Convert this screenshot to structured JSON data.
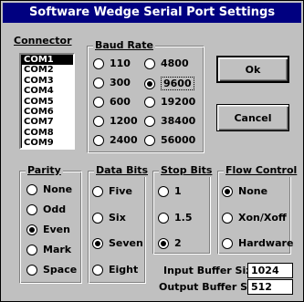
{
  "window": {
    "title": "Software Wedge Serial Port Settings"
  },
  "connector": {
    "label": "Connector",
    "items": [
      "COM1",
      "COM2",
      "COM3",
      "COM4",
      "COM5",
      "COM6",
      "COM7",
      "COM8",
      "COM9"
    ],
    "selected": "COM1"
  },
  "baud": {
    "label": "Baud  Rate",
    "options": [
      "110",
      "300",
      "600",
      "1200",
      "2400",
      "4800",
      "9600",
      "19200",
      "38400",
      "56000"
    ],
    "selected": "9600"
  },
  "parity": {
    "label": "Parity",
    "options": [
      "None",
      "Odd",
      "Even",
      "Mark",
      "Space"
    ],
    "selected": "Even"
  },
  "databits": {
    "label": "Data Bits",
    "options": [
      "Five",
      "Six",
      "Seven",
      "Eight"
    ],
    "selected": "Seven"
  },
  "stopbits": {
    "label": "Stop Bits",
    "options": [
      "1",
      "1.5",
      "2"
    ],
    "selected": "2"
  },
  "flow": {
    "label": "Flow Control",
    "options": [
      "None",
      "Xon/Xoff",
      "Hardware"
    ],
    "selected": "None"
  },
  "buttons": {
    "ok": "Ok",
    "cancel": "Cancel"
  },
  "buffers": {
    "input_label": "Input Buffer Size:",
    "input_value": "1024",
    "output_label": "Output Buffer Size:",
    "output_value": "512"
  }
}
